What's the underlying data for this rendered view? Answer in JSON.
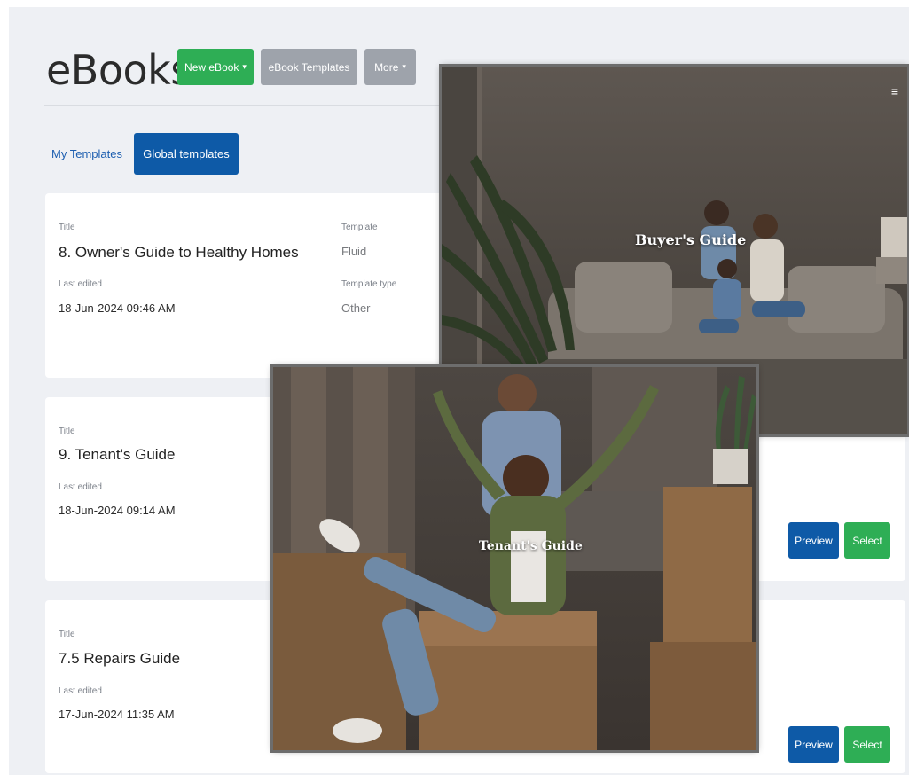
{
  "header": {
    "title": "eBooks",
    "new_ebook_label": "New eBook",
    "ebook_templates_label": "eBook Templates",
    "more_label": "More"
  },
  "tabs": {
    "my_templates": "My Templates",
    "global_templates": "Global templates"
  },
  "labels": {
    "title": "Title",
    "last_edited": "Last edited",
    "template": "Template",
    "template_type": "Template type",
    "preview": "Preview",
    "select": "Select"
  },
  "templates": [
    {
      "title": "8. Owner's Guide to Healthy Homes",
      "last_edited": "18-Jun-2024 09:46 AM",
      "template": "Fluid",
      "template_type": "Other"
    },
    {
      "title": "9. Tenant's Guide",
      "last_edited": "18-Jun-2024 09:14 AM"
    },
    {
      "title": "7.5 Repairs Guide",
      "last_edited": "17-Jun-2024 11:35 AM"
    }
  ],
  "previews": {
    "buyer_caption": "Buyer's Guide",
    "tenant_caption": "Tenant's Guide",
    "menu_icon": "≡"
  },
  "colors": {
    "green": "#2eae55",
    "blue": "#0e5aa7",
    "gray_button": "#9ea3ab",
    "page_bg": "#eef0f4"
  }
}
